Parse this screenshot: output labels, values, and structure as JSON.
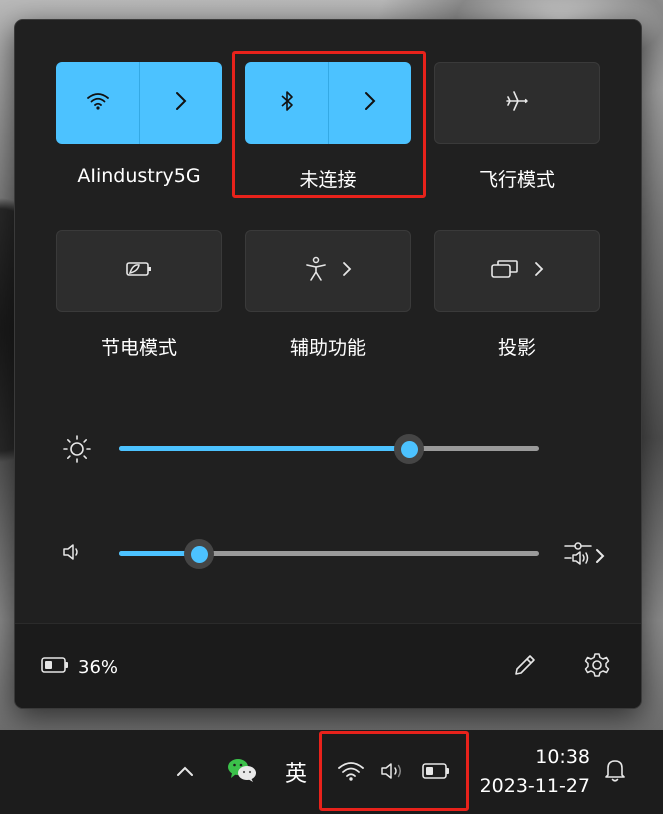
{
  "quick_settings": {
    "tiles": [
      {
        "label": "AIindustry5G",
        "icon": "wifi-icon",
        "state": "on",
        "has_arrow": true
      },
      {
        "label": "未连接",
        "icon": "bluetooth-icon",
        "state": "on",
        "has_arrow": true
      },
      {
        "label": "飞行模式",
        "icon": "airplane-icon",
        "state": "off",
        "has_arrow": false
      },
      {
        "label": "节电模式",
        "icon": "battery-saver-icon",
        "state": "off",
        "has_arrow": false
      },
      {
        "label": "辅助功能",
        "icon": "accessibility-icon",
        "state": "off",
        "has_arrow": true
      },
      {
        "label": "投影",
        "icon": "project-icon",
        "state": "off",
        "has_arrow": true
      }
    ],
    "brightness": {
      "icon": "brightness-icon",
      "level": 0.69
    },
    "volume": {
      "icon": "speaker-icon",
      "level": 0.19,
      "mixer_icon": "volume-mixer-icon"
    },
    "footer": {
      "battery_percent": "36%",
      "battery_icon": "battery-icon",
      "edit_icon": "pencil-icon",
      "settings_icon": "gear-icon"
    }
  },
  "taskbar": {
    "overflow_icon": "chevron-up-icon",
    "wechat_icon": "wechat-icon",
    "ime_label": "英",
    "tray_icons": [
      "wifi-icon",
      "speaker-icon",
      "battery-icon"
    ],
    "time": "10:38",
    "date": "2023-11-27",
    "notification_icon": "bell-icon"
  },
  "colors": {
    "accent": "#4cc2ff",
    "panel_bg": "#202020",
    "highlight_box": "#e8221b"
  }
}
